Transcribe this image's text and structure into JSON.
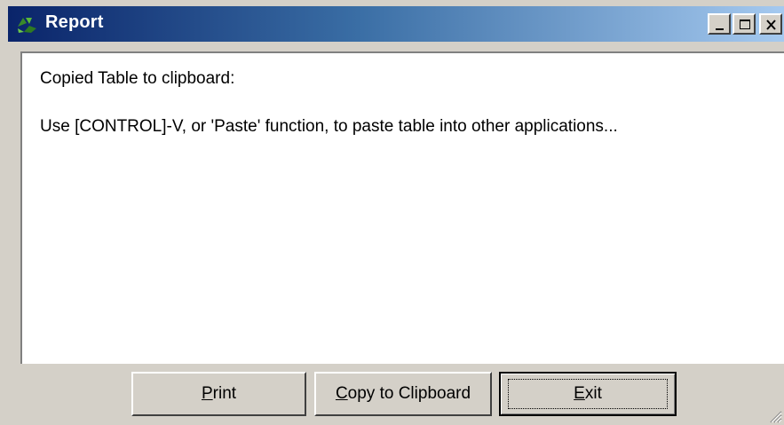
{
  "window": {
    "title": "Report",
    "app_icon": "green-recycle-icon",
    "controls": [
      "minimize-icon",
      "maximize-icon",
      "close-icon"
    ]
  },
  "content": {
    "line1": "Copied Table to clipboard:",
    "line2": "Use [CONTROL]-V, or 'Paste' function, to paste table into other applications..."
  },
  "buttons": {
    "print": {
      "mnemonic": "P",
      "rest": "rint"
    },
    "copy": {
      "mnemonic": "C",
      "rest": "opy to Clipboard"
    },
    "exit": {
      "mnemonic": "E",
      "rest": "xit"
    }
  },
  "colors": {
    "title_gradient_start": "#0a246a",
    "title_gradient_end": "#a6caf0",
    "face": "#d4d0c8",
    "app_icon_green": "#3a8a2a"
  }
}
